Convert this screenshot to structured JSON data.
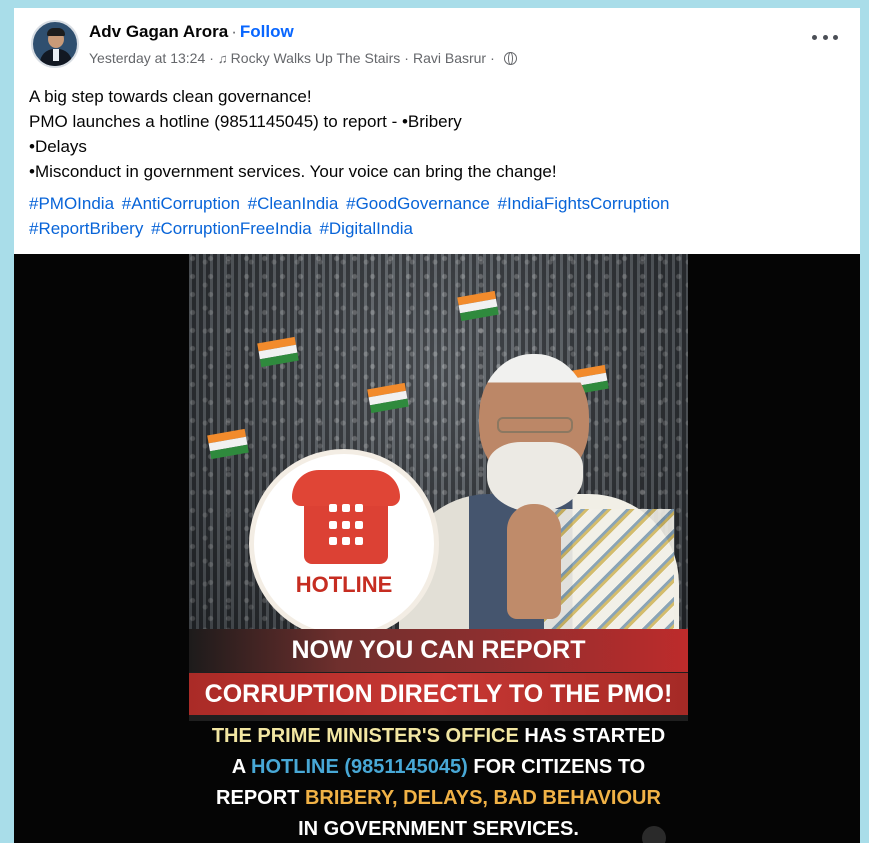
{
  "post": {
    "author": "Adv Gagan Arora",
    "separator": "·",
    "follow_label": "Follow",
    "time": "Yesterday at 13:24",
    "meta_sep": "·",
    "music": "Rocky Walks Up The Stairs",
    "artist": "Ravi Basrur",
    "music_icon_char": "♫",
    "body_lines": [
      "A big step towards clean governance!",
      "PMO launches a hotline (9851145045) to report - •Bribery",
      "•Delays",
      "•Misconduct in government services. Your voice can bring the change!"
    ],
    "hashtags": [
      "#PMOIndia",
      "#AntiCorruption",
      "#CleanIndia",
      "#GoodGovernance",
      "#IndiaFightsCorruption",
      "#ReportBribery",
      "#CorruptionFreeIndia",
      "#DigitalIndia"
    ]
  },
  "poster": {
    "hotline_label": "HOTLINE",
    "banner_line1": "NOW YOU CAN REPORT",
    "banner_line2": "CORRUPTION DIRECTLY TO THE PMO!",
    "body": {
      "line1_a": "THE PRIME MINISTER'S OFFICE",
      "line1_b": " HAS STARTED",
      "line2_a": "A ",
      "line2_b": "HOTLINE (9851145045)",
      "line2_c": " FOR CITIZENS TO",
      "line3_a": "REPORT ",
      "line3_b": "BRIBERY, DELAYS, BAD BEHAVIOUR",
      "line4": "IN GOVERNMENT SERVICES."
    }
  },
  "colors": {
    "page_bg": "#a9dde9",
    "link_blue": "#0866ff",
    "hashtag_blue": "#0864d8",
    "banner_red": "#c83733",
    "poster_yellow": "#f2e6a2",
    "poster_blue": "#48a8d6",
    "poster_orange": "#f1b246"
  },
  "icons": [
    "avatar",
    "music-icon",
    "globe-icon",
    "more-options-icon",
    "telephone-icon"
  ]
}
